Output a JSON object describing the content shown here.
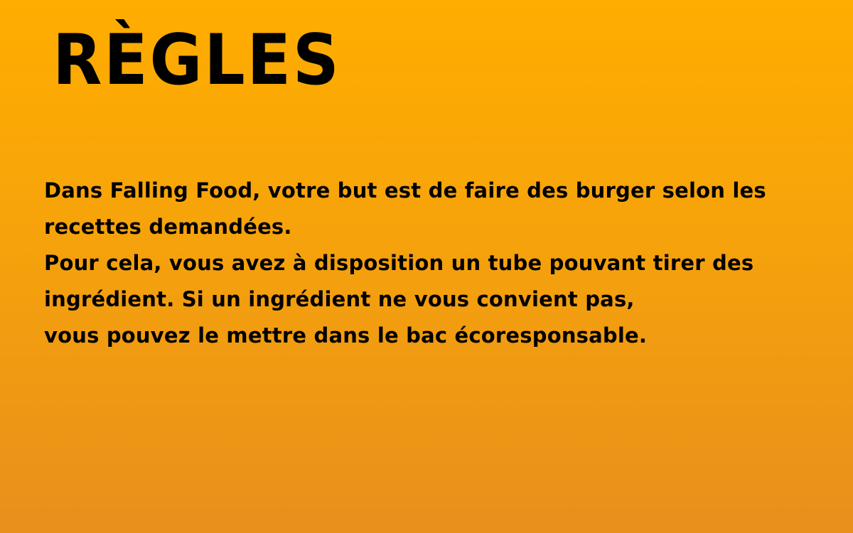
{
  "screen": {
    "title": "RÈGLES",
    "rules_lines": [
      "Dans Falling Food, votre but est de faire des burger selon les",
      "recettes demandées.",
      "Pour cela, vous avez à disposition un tube pouvant tirer des",
      "ingrédient. Si un ingrédient ne vous convient pas,",
      "vous pouvez le mettre dans le bac écoresponsable."
    ],
    "colors": {
      "background_top": "#ffad00",
      "background_bottom": "#e88f1c",
      "text": "#000000"
    }
  }
}
